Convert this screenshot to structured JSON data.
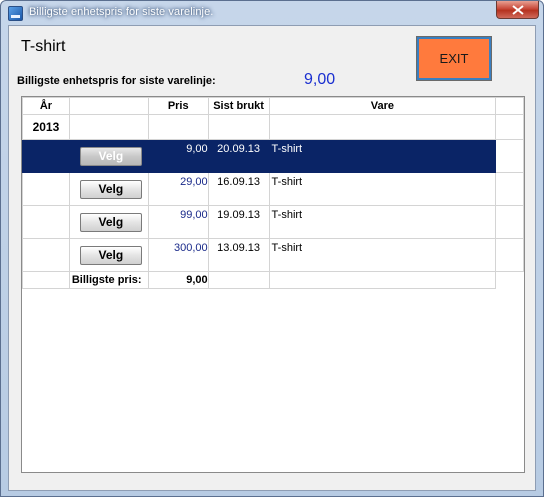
{
  "window": {
    "title": "Billigste enhetspris for siste varelinje."
  },
  "header": {
    "product": "T-shirt",
    "exit_label": "EXIT",
    "cheapest_label": "Billigste enhetspris for siste varelinje:",
    "cheapest_value": "9,00"
  },
  "grid": {
    "columns": {
      "year": "År",
      "action": "",
      "price": "Pris",
      "last_used": "Sist brukt",
      "item": "Vare"
    },
    "year": "2013",
    "rows": [
      {
        "button": "Velg",
        "price": "9,00",
        "date": "20.09.13",
        "item": "T-shirt",
        "selected": true
      },
      {
        "button": "Velg",
        "price": "29,00",
        "date": "16.09.13",
        "item": "T-shirt",
        "selected": false
      },
      {
        "button": "Velg",
        "price": "99,00",
        "date": "19.09.13",
        "item": "T-shirt",
        "selected": false
      },
      {
        "button": "Velg",
        "price": "300,00",
        "date": "13.09.13",
        "item": "T-shirt",
        "selected": false
      }
    ],
    "footer": {
      "label": "Billigste pris:",
      "value": "9,00"
    }
  },
  "colors": {
    "selection": "#0a2466",
    "exit_button": "#ff7a3d",
    "value_text": "#1a2fd0"
  }
}
